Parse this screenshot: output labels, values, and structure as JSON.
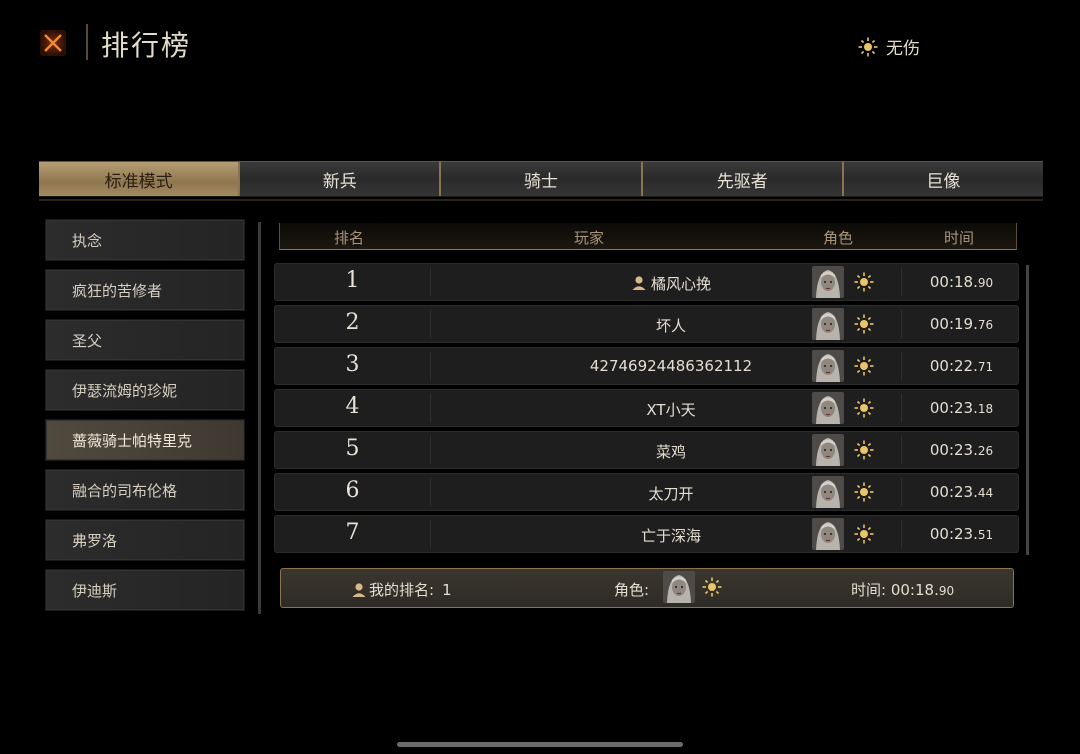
{
  "header": {
    "title": "排行榜",
    "mode_label": "无伤"
  },
  "tabs": [
    {
      "label": "标准模式",
      "active": true
    },
    {
      "label": "新兵",
      "active": false
    },
    {
      "label": "骑士",
      "active": false
    },
    {
      "label": "先驱者",
      "active": false
    },
    {
      "label": "巨像",
      "active": false
    }
  ],
  "bosses": [
    {
      "label": "执念",
      "active": false
    },
    {
      "label": "疯狂的苦修者",
      "active": false
    },
    {
      "label": "圣父",
      "active": false
    },
    {
      "label": "伊瑟流姆的珍妮",
      "active": false
    },
    {
      "label": "蔷薇骑士帕特里克",
      "active": true
    },
    {
      "label": "融合的司布伦格",
      "active": false
    },
    {
      "label": "弗罗洛",
      "active": false
    },
    {
      "label": "伊迪斯",
      "active": false
    }
  ],
  "table": {
    "headers": {
      "rank": "排名",
      "player": "玩家",
      "role": "角色",
      "time": "时间"
    },
    "rows": [
      {
        "rank": "1",
        "player": "橘风心挽",
        "is_self": true,
        "time_main": "00:18.",
        "time_ms": "90"
      },
      {
        "rank": "2",
        "player": "坏人",
        "is_self": false,
        "time_main": "00:19.",
        "time_ms": "76"
      },
      {
        "rank": "3",
        "player": "42746924486362112",
        "is_self": false,
        "time_main": "00:22.",
        "time_ms": "71"
      },
      {
        "rank": "4",
        "player": "XT小天",
        "is_self": false,
        "time_main": "00:23.",
        "time_ms": "18"
      },
      {
        "rank": "5",
        "player": "菜鸡",
        "is_self": false,
        "time_main": "00:23.",
        "time_ms": "26"
      },
      {
        "rank": "6",
        "player": "太刀开",
        "is_self": false,
        "time_main": "00:23.",
        "time_ms": "44"
      },
      {
        "rank": "7",
        "player": "亡于深海",
        "is_self": false,
        "time_main": "00:23.",
        "time_ms": "51"
      }
    ]
  },
  "my_rank": {
    "rank_label": "我的排名:",
    "rank_value": "1",
    "role_label": "角色:",
    "time_label": "时间:",
    "time_main": "00:18.",
    "time_ms": "90"
  },
  "colors": {
    "accent": "#b59d73",
    "gold_icon": "#e9c46a",
    "close_orange": "#e07a2c"
  }
}
